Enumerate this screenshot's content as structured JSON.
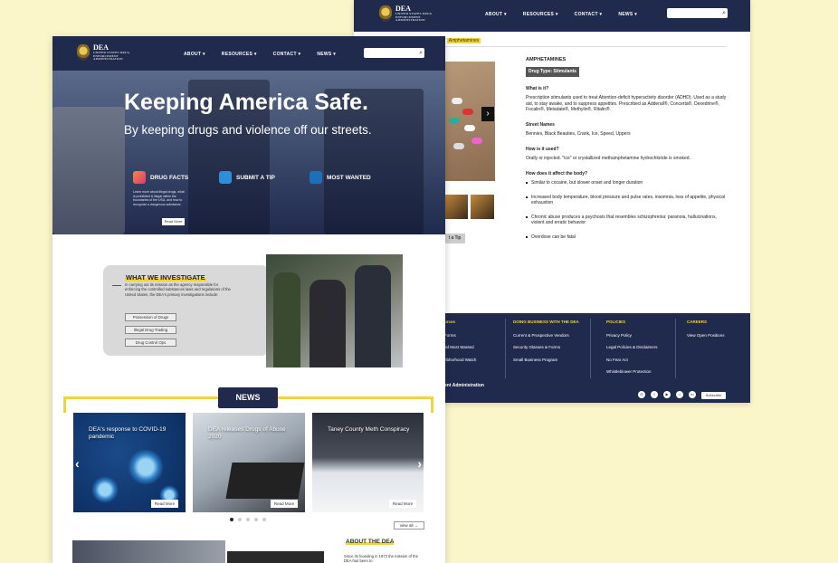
{
  "brand": {
    "logo_title": "DEA",
    "logo_sub": "UNITED STATES DRUG ENFORCEMENT ADMINISTRATION"
  },
  "nav": {
    "items": [
      "ABOUT",
      "RESOURCES",
      "CONTACT",
      "NEWS"
    ]
  },
  "back_page": {
    "breadcrumb_current": "Amphetamines",
    "drug_name": "AMPHETAMINES",
    "drug_type": "Drug Type: Stimulants",
    "q1": "What is it?",
    "a1": "Prescription stimulants used to treat Attention-deficit hyperactivity disorder (ADHD). Used as a study aid, to stay awake, and to suppress appetites. Prescribed as Adderall®, Concerta®, Dexedrine®, Focalin®, Metadate®, Methylin®, Ritalin®.",
    "q2": "Street Names",
    "a2": "Bennies, Black Beauties, Crank, Ice, Speed, Uppers",
    "q3": "How is it used?",
    "a3": "Orally or injected. \"Ice\" or crystallized methamphetamine hydrochloride is smoked.",
    "q4": "How does it affect the body?",
    "effects": [
      "Similar to cocaine, but slower onset and longer duration",
      "Increased body temperature, blood pressure and pulse rates, insomnia, loss of appetite, physical exhaustion",
      "Chronic abuse produces a psychosis that resembles schizophrenia: paranoia, hallucinations, violent and erratic behavior",
      "Overdose can be fatal"
    ],
    "tip_button": "t a Tip",
    "footer": {
      "col1_head": "urces",
      "col1_items": [
        "Forms",
        "ed Most Wanted",
        "hbhorhood Watch"
      ],
      "col2_head": "DOING BUSINESS WITH THE DEA",
      "col2_items": [
        "Current & Prospective Vendors",
        "Security Glasses & Forms",
        "Small Business Program"
      ],
      "col3_head": "POLICIES",
      "col3_items": [
        "Privacy Policy",
        "Legal Policies & Disclaimers",
        "No Fear Act",
        "Whistleblower Protection"
      ],
      "col4_head": "CAREERS",
      "col4_items": [
        "View Open Positions"
      ],
      "agency": "ent Administration",
      "subscribe": "Subscribe"
    }
  },
  "front_page": {
    "hero_title": "Keeping America Safe.",
    "hero_subtitle": "By keeping drugs and violence off our streets.",
    "quick_links": [
      "DRUG FACTS",
      "SUBMIT A TIP",
      "MOST WANTED"
    ],
    "drug_facts_desc": "Learn more about illegal drugs, what is prohibited & illegal within the boundaries of the USA, and how to recognize a dangerous substance.",
    "read_more_small": "Read More",
    "investigate_title": "WHAT WE INVESTIGATE",
    "investigate_text": "In carrying out its mission as the agency responsible for enforcing the controlled substances laws and regulations of the United States, the DEA's primary investigations include:",
    "investigate_buttons": [
      "Possession of Drugs",
      "Illegal Drug Trading",
      "Drug Control Ops"
    ],
    "news_label": "NEWS",
    "news_cards": [
      {
        "title": "DEA's response to COVID-19 pandemic",
        "read_more": "Read More"
      },
      {
        "title": "DEA releases Drugs of Abuse 2020",
        "read_more": "Read More"
      },
      {
        "title": "Taney County Meth Conspiracy",
        "read_more": "Read More"
      }
    ],
    "view_all": "view all",
    "about_title": "ABOUT THE DEA",
    "about_text": "Since its founding in 1973 the mission of the DEA has been to"
  }
}
